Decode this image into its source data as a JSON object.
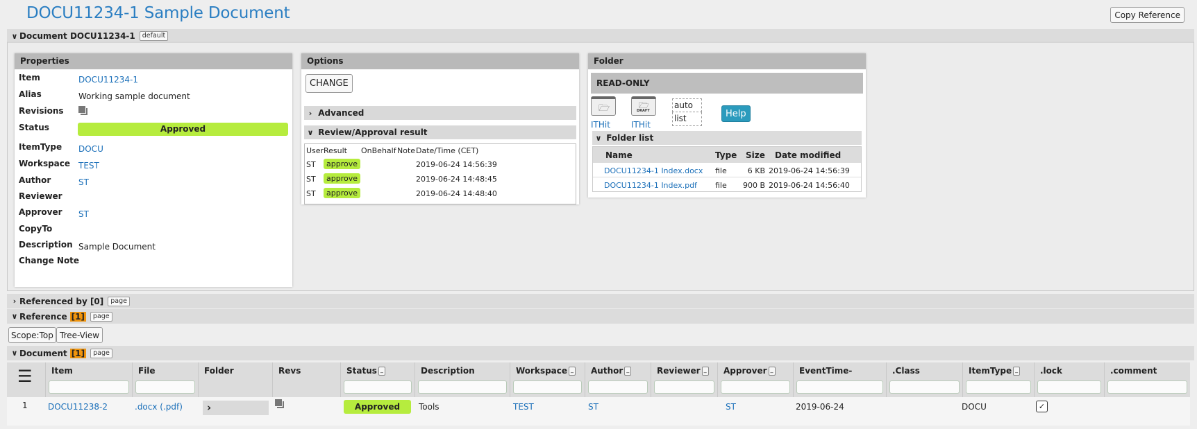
{
  "header": {
    "title": "DOCU11234-1 Sample Document",
    "copy_reference_label": "Copy Reference"
  },
  "document_section": {
    "title": "Document DOCU11234-1",
    "tag": "default"
  },
  "properties": {
    "title": "Properties",
    "rows": [
      {
        "label": "Item",
        "value": "DOCU11234-1",
        "type": "link"
      },
      {
        "label": "Alias",
        "value": "Working sample document",
        "type": "text"
      },
      {
        "label": "Revisions",
        "value": "",
        "type": "icon",
        "icon": "revisions-icon"
      },
      {
        "label": "Status",
        "value": "Approved",
        "type": "status"
      },
      {
        "label": "ItemType",
        "value": "DOCU",
        "type": "link"
      },
      {
        "label": "Workspace",
        "value": "TEST",
        "type": "link"
      },
      {
        "label": "Author",
        "value": "ST",
        "type": "link"
      },
      {
        "label": "Reviewer",
        "value": "",
        "type": "text"
      },
      {
        "label": "Approver",
        "value": "ST",
        "type": "link"
      },
      {
        "label": "CopyTo",
        "value": "",
        "type": "text"
      },
      {
        "label": "Description",
        "value": "Sample Document",
        "type": "text"
      },
      {
        "label": "Change Note",
        "value": "",
        "type": "text"
      }
    ]
  },
  "options": {
    "title": "Options",
    "change_label": "CHANGE",
    "advanced_label": "Advanced",
    "review_label": "Review/Approval result",
    "review_headers": {
      "user": "User",
      "result": "Result",
      "onbehalf": "OnBehalf",
      "note": "Note",
      "datetime": "Date/Time (CET)"
    },
    "review_rows": [
      {
        "user": "ST",
        "result": "approve",
        "datetime": "2019-06-24 14:56:39"
      },
      {
        "user": "ST",
        "result": "approve",
        "datetime": "2019-06-24 14:48:45"
      },
      {
        "user": "ST",
        "result": "approve",
        "datetime": "2019-06-24 14:48:40"
      }
    ]
  },
  "folder": {
    "title": "Folder",
    "mode": "READ-ONLY",
    "icon1_label": "ITHit",
    "icon2_label": "ITHit",
    "icon2_badge": "DRAFT",
    "view_auto": "auto",
    "view_list": "list",
    "help_label": "Help",
    "list_title": "Folder list",
    "headers": {
      "name": "Name",
      "type": "Type",
      "size": "Size",
      "modified": "Date modified"
    },
    "files": [
      {
        "name": "DOCU11234-1 Index.docx",
        "type": "file",
        "size": "6 KB",
        "modified": "2019-06-24 14:56:39"
      },
      {
        "name": "DOCU11234-1 Index.pdf",
        "type": "file",
        "size": "900 B",
        "modified": "2019-06-24 14:56:40"
      }
    ]
  },
  "referenced_by": {
    "title": "Referenced by [0]",
    "tag": "page"
  },
  "reference": {
    "title": "Reference",
    "count": "[1]",
    "tag": "page",
    "scope_label": "Scope:Top",
    "tree_label": "Tree-View"
  },
  "document_list": {
    "title": "Document",
    "count": "[1]",
    "tag": "page",
    "columns": [
      "Item",
      "File",
      "Folder",
      "Revs",
      "Status",
      "Description",
      "Workspace",
      "Author",
      "Reviewer",
      "Approver",
      "EventTime-",
      ".Class",
      "ItemType",
      ".lock",
      ".comment"
    ],
    "rows": [
      {
        "index": "1",
        "item": "DOCU11238-2",
        "file": ".docx (.pdf)",
        "status": "Approved",
        "description": "Tools",
        "workspace": "TEST",
        "author": "ST",
        "reviewer": "",
        "approver": "ST",
        "eventtime": "2019-06-24",
        "class": "",
        "itemtype": "DOCU",
        "lock": true,
        "comment": ""
      }
    ]
  },
  "colors": {
    "title": "#2a7ec2",
    "link": "#1a6fb9",
    "approved": "#b6ec3e",
    "count_badge": "#f0940c",
    "help": "#2b9bbd"
  }
}
